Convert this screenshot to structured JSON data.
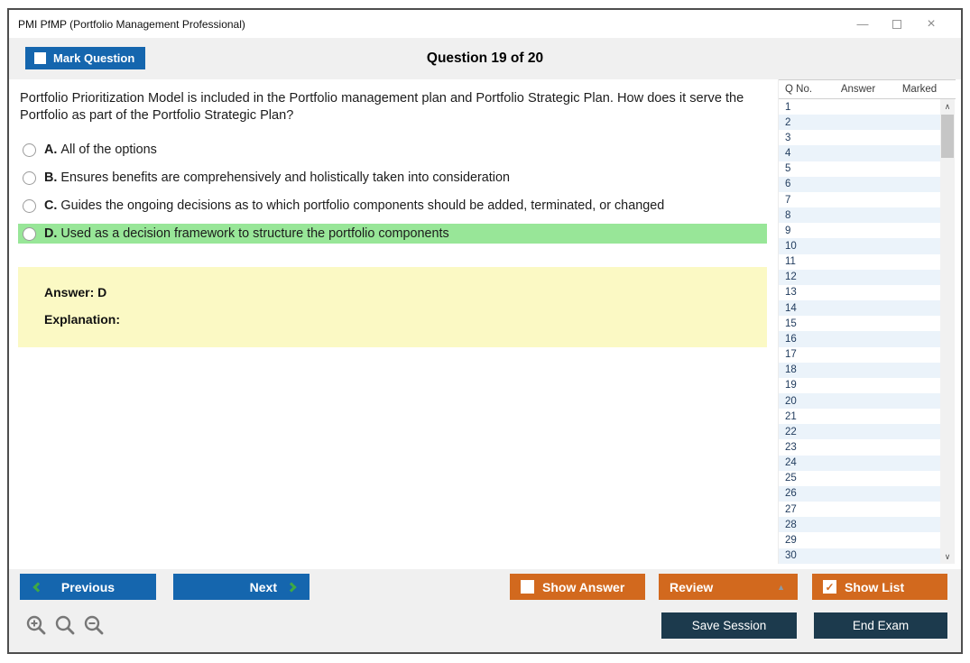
{
  "window": {
    "title": "PMI PfMP (Portfolio Management Professional)"
  },
  "icons": {
    "minimize_glyph": "—",
    "maximize_glyph": "",
    "close_glyph": "×",
    "review_arrow": "▲",
    "scroll_up": "∧",
    "scroll_down": "∨",
    "checkmark": "✓"
  },
  "header": {
    "mark_question_label": "Mark Question",
    "mark_question_checked": false,
    "question_counter": "Question 19 of 20"
  },
  "question": {
    "text": "Portfolio Prioritization Model is included in the Portfolio management plan and Portfolio Strategic Plan. How does it serve the Portfolio as part of the Portfolio Strategic Plan?",
    "options": [
      {
        "letter": "A.",
        "text": "All of the options",
        "highlighted": false
      },
      {
        "letter": "B.",
        "text": "Ensures benefits are comprehensively and holistically taken into consideration",
        "highlighted": false
      },
      {
        "letter": "C.",
        "text": "Guides the ongoing decisions as to which portfolio components should be added, terminated, or changed",
        "highlighted": false
      },
      {
        "letter": "D.",
        "text": "Used as a decision framework to structure the portfolio components",
        "highlighted": true
      }
    ]
  },
  "answer_panel": {
    "answer_label": "Answer: D",
    "explanation_label": "Explanation:"
  },
  "question_list": {
    "columns": [
      "Q No.",
      "Answer",
      "Marked"
    ],
    "rows": [
      1,
      2,
      3,
      4,
      5,
      6,
      7,
      8,
      9,
      10,
      11,
      12,
      13,
      14,
      15,
      16,
      17,
      18,
      19,
      20,
      21,
      22,
      23,
      24,
      25,
      26,
      27,
      28,
      29,
      30
    ]
  },
  "footer": {
    "previous_label": "Previous",
    "next_label": "Next",
    "show_answer_label": "Show Answer",
    "show_answer_checked": false,
    "review_label": "Review",
    "show_list_label": "Show List",
    "show_list_checked": true,
    "save_session_label": "Save Session",
    "end_exam_label": "End Exam"
  },
  "colors": {
    "accent_blue": "#1566ae",
    "accent_orange": "#d2691e",
    "dark_navy": "#1c3a4d",
    "highlight_green": "#98e698",
    "answer_yellow": "#fbf9c4",
    "band_gray": "#f0f0f0",
    "alt_row_blue": "#ebf3fa",
    "chevron_green": "#3fa944"
  }
}
